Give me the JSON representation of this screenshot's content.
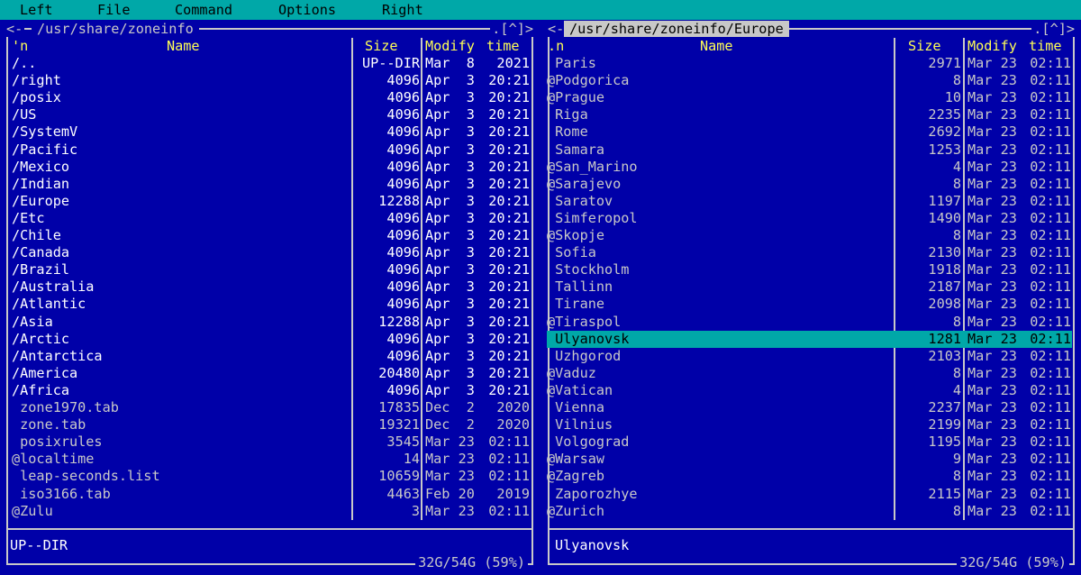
{
  "menu": {
    "items": [
      "Left",
      "File",
      "Command",
      "Options",
      "Right"
    ]
  },
  "left_panel": {
    "title": "/usr/share/zoneinfo",
    "corner_left": "<-",
    "corner_right": ".[^]>",
    "headers": {
      "name_sort": "'n",
      "name": "Name",
      "size": "Size",
      "modify": "Modify",
      "time": "time"
    },
    "rows": [
      {
        "name": "/..",
        "size": "UP--DIR",
        "date": "Mar  8",
        "time": "2021",
        "type": "dir"
      },
      {
        "name": "/right",
        "size": "4096",
        "date": "Apr  3",
        "time": "20:21",
        "type": "dir"
      },
      {
        "name": "/posix",
        "size": "4096",
        "date": "Apr  3",
        "time": "20:21",
        "type": "dir"
      },
      {
        "name": "/US",
        "size": "4096",
        "date": "Apr  3",
        "time": "20:21",
        "type": "dir"
      },
      {
        "name": "/SystemV",
        "size": "4096",
        "date": "Apr  3",
        "time": "20:21",
        "type": "dir"
      },
      {
        "name": "/Pacific",
        "size": "4096",
        "date": "Apr  3",
        "time": "20:21",
        "type": "dir"
      },
      {
        "name": "/Mexico",
        "size": "4096",
        "date": "Apr  3",
        "time": "20:21",
        "type": "dir"
      },
      {
        "name": "/Indian",
        "size": "4096",
        "date": "Apr  3",
        "time": "20:21",
        "type": "dir"
      },
      {
        "name": "/Europe",
        "size": "12288",
        "date": "Apr  3",
        "time": "20:21",
        "type": "dir"
      },
      {
        "name": "/Etc",
        "size": "4096",
        "date": "Apr  3",
        "time": "20:21",
        "type": "dir"
      },
      {
        "name": "/Chile",
        "size": "4096",
        "date": "Apr  3",
        "time": "20:21",
        "type": "dir"
      },
      {
        "name": "/Canada",
        "size": "4096",
        "date": "Apr  3",
        "time": "20:21",
        "type": "dir"
      },
      {
        "name": "/Brazil",
        "size": "4096",
        "date": "Apr  3",
        "time": "20:21",
        "type": "dir"
      },
      {
        "name": "/Australia",
        "size": "4096",
        "date": "Apr  3",
        "time": "20:21",
        "type": "dir"
      },
      {
        "name": "/Atlantic",
        "size": "4096",
        "date": "Apr  3",
        "time": "20:21",
        "type": "dir"
      },
      {
        "name": "/Asia",
        "size": "12288",
        "date": "Apr  3",
        "time": "20:21",
        "type": "dir"
      },
      {
        "name": "/Arctic",
        "size": "4096",
        "date": "Apr  3",
        "time": "20:21",
        "type": "dir"
      },
      {
        "name": "/Antarctica",
        "size": "4096",
        "date": "Apr  3",
        "time": "20:21",
        "type": "dir"
      },
      {
        "name": "/America",
        "size": "20480",
        "date": "Apr  3",
        "time": "20:21",
        "type": "dir"
      },
      {
        "name": "/Africa",
        "size": "4096",
        "date": "Apr  3",
        "time": "20:21",
        "type": "dir"
      },
      {
        "name": " zone1970.tab",
        "size": "17835",
        "date": "Dec  2",
        "time": "2020",
        "type": "file"
      },
      {
        "name": " zone.tab",
        "size": "19321",
        "date": "Dec  2",
        "time": "2020",
        "type": "file"
      },
      {
        "name": " posixrules",
        "size": "3545",
        "date": "Mar 23",
        "time": "02:11",
        "type": "file"
      },
      {
        "name": "@localtime",
        "size": "14",
        "date": "Mar 23",
        "time": "02:11",
        "type": "file"
      },
      {
        "name": " leap-seconds.list",
        "size": "10659",
        "date": "Mar 23",
        "time": "02:11",
        "type": "file"
      },
      {
        "name": " iso3166.tab",
        "size": "4463",
        "date": "Feb 20",
        "time": "2019",
        "type": "file"
      },
      {
        "name": "@Zulu",
        "size": "3",
        "date": "Mar 23",
        "time": "02:11",
        "type": "file"
      }
    ],
    "status": "UP--DIR",
    "disk": "32G/54G (59%)"
  },
  "right_panel": {
    "title": "/usr/share/zoneinfo/Europe",
    "corner_left": "<-",
    "corner_right": ".[^]>",
    "headers": {
      "name_sort": ".n",
      "name": "Name",
      "size": "Size",
      "modify": "Modify",
      "time": "time"
    },
    "rows": [
      {
        "name": " Paris",
        "size": "2971",
        "date": "Mar 23",
        "time": "02:11",
        "type": "file"
      },
      {
        "name": "@Podgorica",
        "size": "8",
        "date": "Mar 23",
        "time": "02:11",
        "type": "file"
      },
      {
        "name": "@Prague",
        "size": "10",
        "date": "Mar 23",
        "time": "02:11",
        "type": "file"
      },
      {
        "name": " Riga",
        "size": "2235",
        "date": "Mar 23",
        "time": "02:11",
        "type": "file"
      },
      {
        "name": " Rome",
        "size": "2692",
        "date": "Mar 23",
        "time": "02:11",
        "type": "file"
      },
      {
        "name": " Samara",
        "size": "1253",
        "date": "Mar 23",
        "time": "02:11",
        "type": "file"
      },
      {
        "name": "@San_Marino",
        "size": "4",
        "date": "Mar 23",
        "time": "02:11",
        "type": "file"
      },
      {
        "name": "@Sarajevo",
        "size": "8",
        "date": "Mar 23",
        "time": "02:11",
        "type": "file"
      },
      {
        "name": " Saratov",
        "size": "1197",
        "date": "Mar 23",
        "time": "02:11",
        "type": "file"
      },
      {
        "name": " Simferopol",
        "size": "1490",
        "date": "Mar 23",
        "time": "02:11",
        "type": "file"
      },
      {
        "name": "@Skopje",
        "size": "8",
        "date": "Mar 23",
        "time": "02:11",
        "type": "file"
      },
      {
        "name": " Sofia",
        "size": "2130",
        "date": "Mar 23",
        "time": "02:11",
        "type": "file"
      },
      {
        "name": " Stockholm",
        "size": "1918",
        "date": "Mar 23",
        "time": "02:11",
        "type": "file"
      },
      {
        "name": " Tallinn",
        "size": "2187",
        "date": "Mar 23",
        "time": "02:11",
        "type": "file"
      },
      {
        "name": " Tirane",
        "size": "2098",
        "date": "Mar 23",
        "time": "02:11",
        "type": "file"
      },
      {
        "name": "@Tiraspol",
        "size": "8",
        "date": "Mar 23",
        "time": "02:11",
        "type": "file"
      },
      {
        "name": " Ulyanovsk",
        "size": "1281",
        "date": "Mar 23",
        "time": "02:11",
        "type": "selected"
      },
      {
        "name": " Uzhgorod",
        "size": "2103",
        "date": "Mar 23",
        "time": "02:11",
        "type": "file"
      },
      {
        "name": "@Vaduz",
        "size": "8",
        "date": "Mar 23",
        "time": "02:11",
        "type": "file"
      },
      {
        "name": "@Vatican",
        "size": "4",
        "date": "Mar 23",
        "time": "02:11",
        "type": "file"
      },
      {
        "name": " Vienna",
        "size": "2237",
        "date": "Mar 23",
        "time": "02:11",
        "type": "file"
      },
      {
        "name": " Vilnius",
        "size": "2199",
        "date": "Mar 23",
        "time": "02:11",
        "type": "file"
      },
      {
        "name": " Volgograd",
        "size": "1195",
        "date": "Mar 23",
        "time": "02:11",
        "type": "file"
      },
      {
        "name": "@Warsaw",
        "size": "9",
        "date": "Mar 23",
        "time": "02:11",
        "type": "file"
      },
      {
        "name": "@Zagreb",
        "size": "8",
        "date": "Mar 23",
        "time": "02:11",
        "type": "file"
      },
      {
        "name": " Zaporozhye",
        "size": "2115",
        "date": "Mar 23",
        "time": "02:11",
        "type": "file"
      },
      {
        "name": "@Zurich",
        "size": "8",
        "date": "Mar 23",
        "time": "02:11",
        "type": "file"
      }
    ],
    "status": "Ulyanovsk",
    "disk": "32G/54G (59%)"
  },
  "colors": {
    "background": "#0000a8",
    "menubar": "#00a8a8",
    "selection": "#00a8a8",
    "frame": "#c8c8c8",
    "header_text": "#ffff55",
    "directory_text": "#ffffff",
    "file_text": "#c8c8c8"
  }
}
